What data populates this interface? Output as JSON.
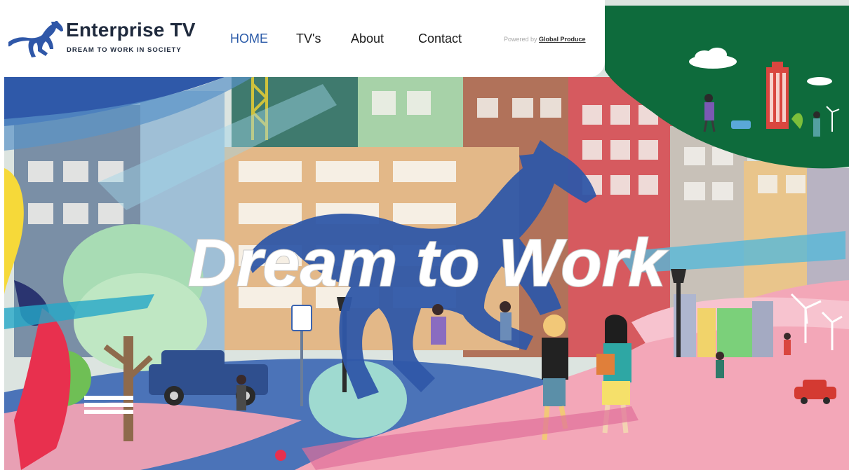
{
  "brand": {
    "name": "Enterprise TV",
    "tagline": "DREAM TO WORK IN SOCIETY"
  },
  "nav": {
    "items": [
      {
        "label": "HOME",
        "active": true
      },
      {
        "label": "TV's",
        "active": false
      },
      {
        "label": "About",
        "active": false
      },
      {
        "label": "Contact",
        "active": false
      }
    ]
  },
  "powered": {
    "prefix": "Powered by",
    "link_label": "Global Produce"
  },
  "hero": {
    "headline": "Dream to Work"
  },
  "colors": {
    "accent": "#2a5aa8",
    "brand_dark": "#1f2a3d",
    "horse_blue": "#2f57a8",
    "park_green": "#0e6b3c",
    "hill_pink": "#f3a7b8"
  }
}
